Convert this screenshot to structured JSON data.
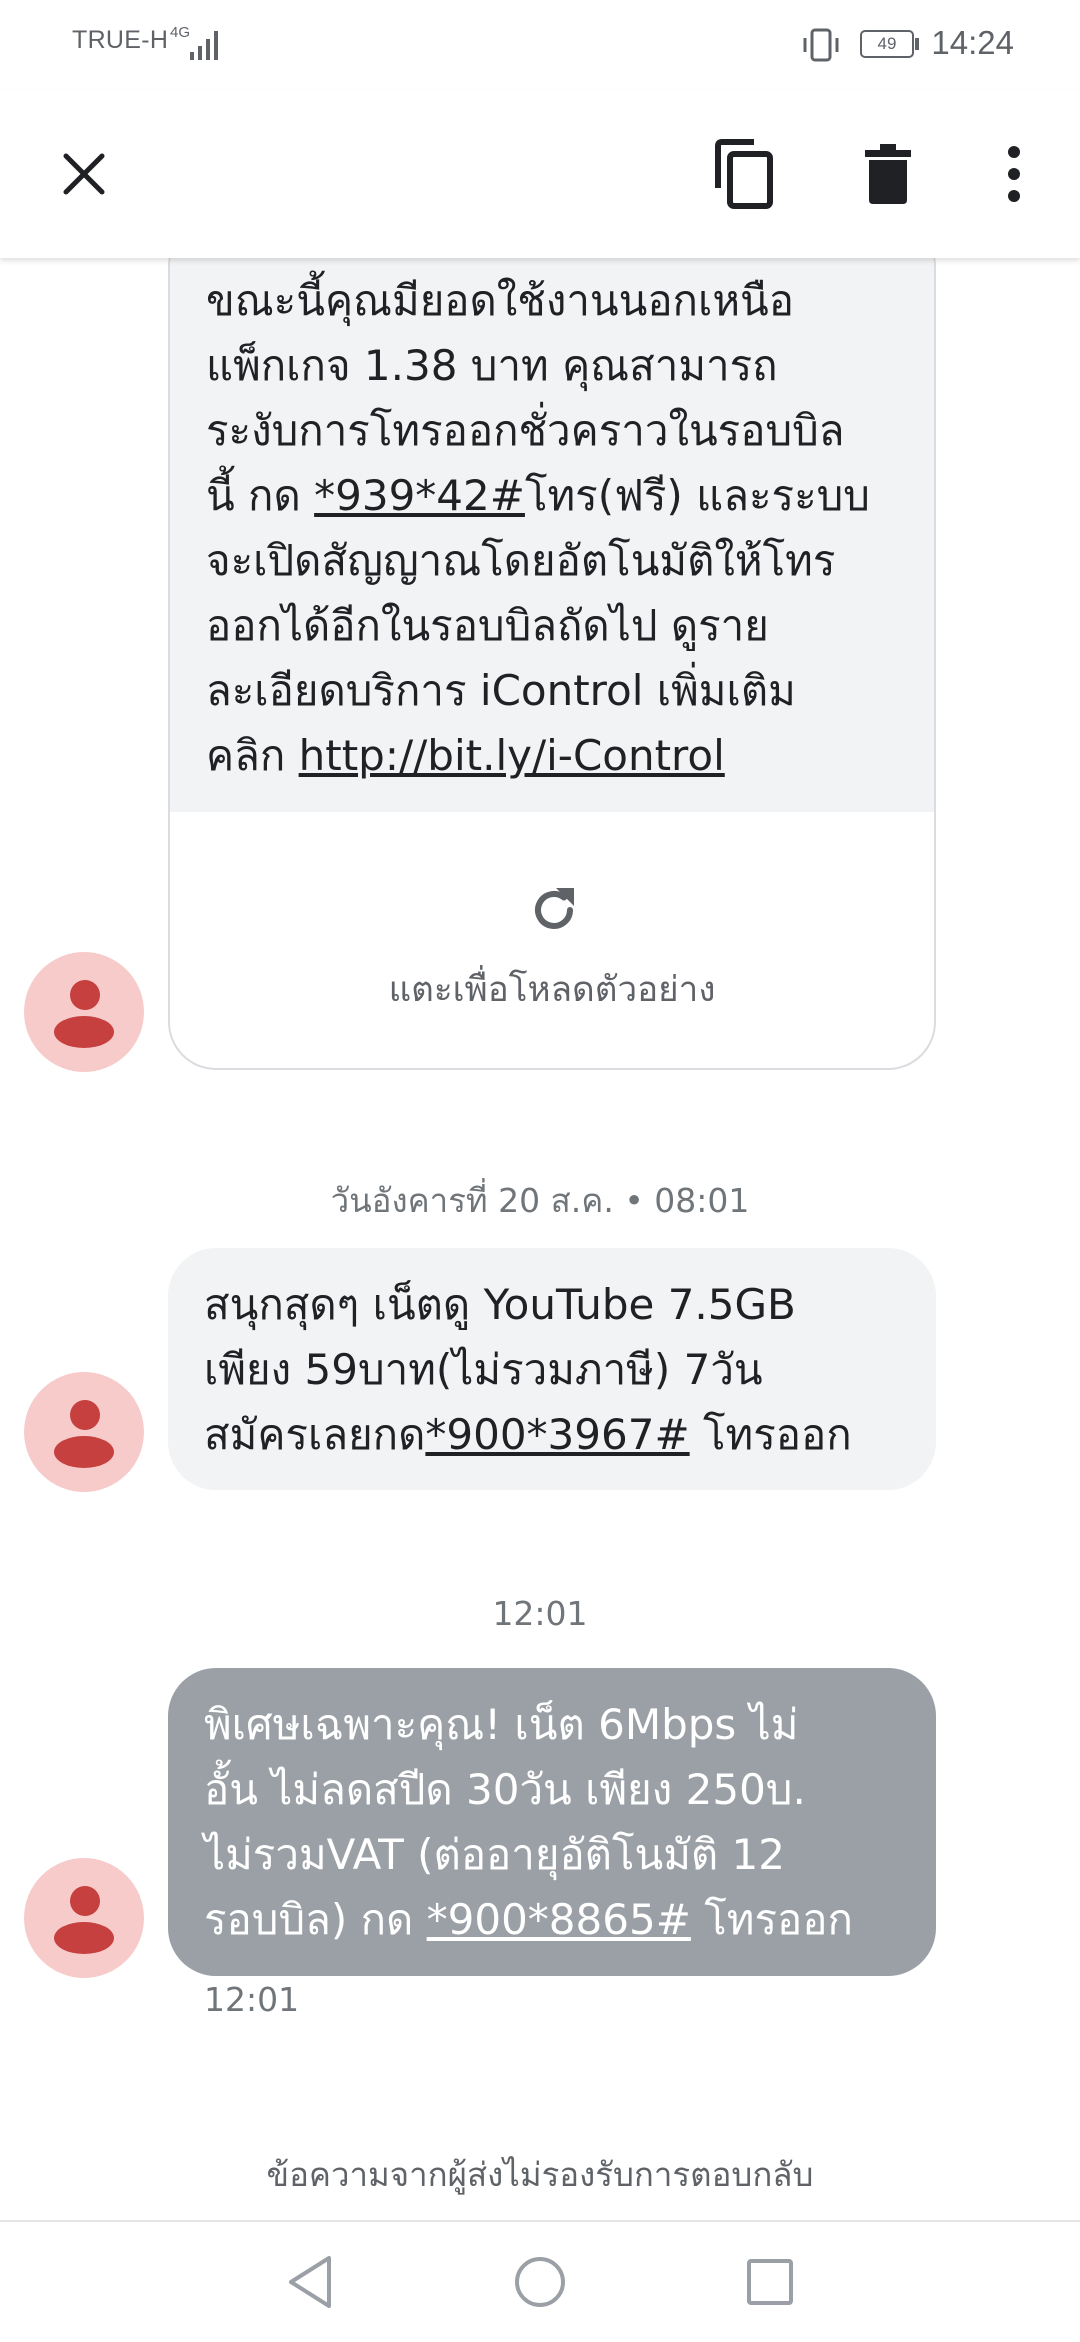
{
  "status_bar": {
    "carrier": "TRUE-H",
    "network": "4G",
    "battery": "49",
    "time": "14:24"
  },
  "app_bar": {
    "icons": [
      "close-icon",
      "copy-icon",
      "delete-icon",
      "more-vert-icon"
    ]
  },
  "messages": {
    "m1": {
      "text_before_code": "ขณะนี้คุณมียอดใช้งานนอกเหนือ\nแพ็กเกจ 1.38 บาท คุณสามารถ\nระงับการโทรออกชั่วคราวในรอบบิล\nนี้ กด ",
      "code": "*939*42#",
      "text_after_code": "โทร(ฟรี) และระบบ\nจะเปิดสัญญาณโดยอัตโนมัติให้โทร\nออกได้อีกในรอบบิลถัดไป ดูราย\nละเอียดบริการ iControl เพิ่มเติม\nคลิก ",
      "link": "http://bit.ly/i-Control",
      "preview_label": "แตะเพื่อโหลดตัวอย่าง"
    },
    "ts2": "วันอังคารที่ 20 ส.ค. • 08:01",
    "m2": {
      "text_before_code": "สนุกสุดๆ เน็ตดู YouTube 7.5GB\nเพียง 59บาท(ไม่รวมภาษี) 7วัน\nสมัครเลยกด",
      "code": "*900*3967#",
      "text_after_code": " โทรออก"
    },
    "ts3": "12:01",
    "m3": {
      "text_before_code": "พิเศษเฉพาะคุณ! เน็ต 6Mbps ไม่\nอั้น ไม่ลดสปีด 30วัน เพียง 250บ.\nไม่รวมVAT (ต่ออายุอัติโนมัติ 12\nรอบบิล) กด ",
      "code": "*900*8865#",
      "text_after_code": " โทรออก",
      "time": "12:01"
    }
  },
  "footer_note": "ข้อความจากผู้ส่งไม่รองรับการตอบกลับ",
  "colors": {
    "incoming_bubble": "#f1f3f4",
    "selected_bubble": "#9aa0a6",
    "avatar_bg": "#f8cbcb",
    "avatar_fg": "#c5403e",
    "icon": "#5f6368"
  }
}
